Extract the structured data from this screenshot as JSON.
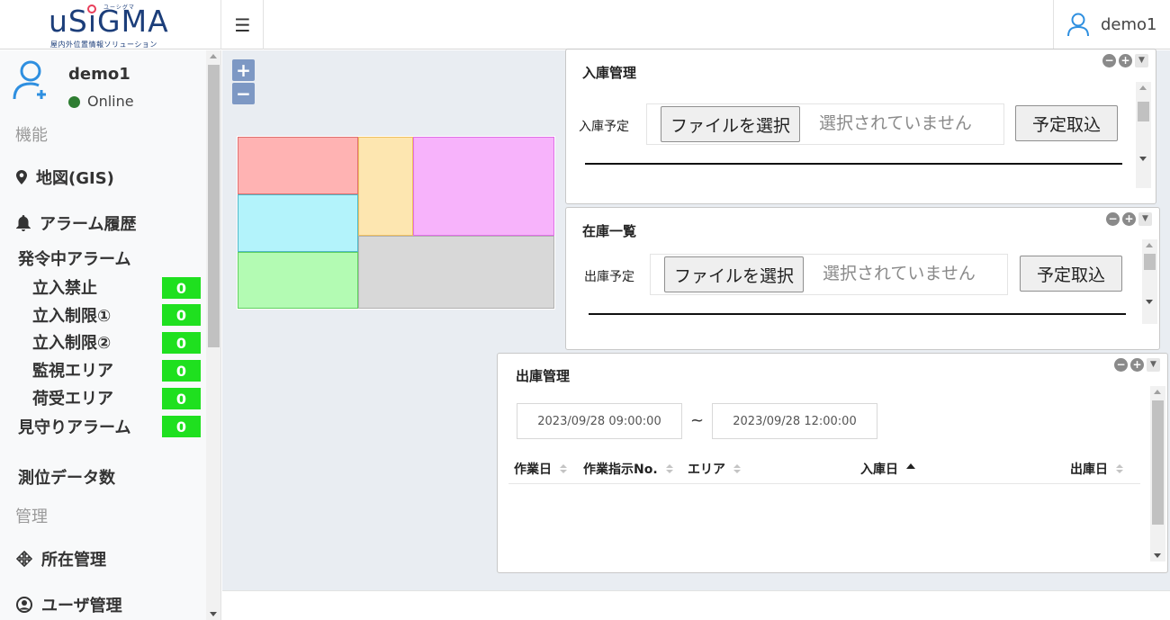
{
  "header": {
    "logo_text": "uSiGMA",
    "logo_ruby": "ユーシグマ",
    "logo_subtitle": "屋内外位置情報ソリューション",
    "menu_icon": "hamburger-icon",
    "user_name": "demo1"
  },
  "sidebar": {
    "profile_name": "demo1",
    "status": "Online",
    "status_color": "#2e7d32",
    "section_function": "機能",
    "nav_map": "地図(GIS)",
    "nav_alarm_history": "アラーム履歴",
    "active_alarms_label": "発令中アラーム",
    "alarms": [
      {
        "label": "立入禁止",
        "count": "0"
      },
      {
        "label": "立入制限①",
        "count": "0"
      },
      {
        "label": "立入制限②",
        "count": "0"
      },
      {
        "label": "監視エリア",
        "count": "0"
      },
      {
        "label": "荷受エリア",
        "count": "0"
      }
    ],
    "watch_alarm": {
      "label": "見守りアラーム",
      "count": "0"
    },
    "positioning_label": "測位データ数",
    "section_admin": "管理",
    "nav_location": "所在管理",
    "nav_users": "ユーザ管理",
    "badge_color": "#1fe01f"
  },
  "map": {
    "zoom_in": "+",
    "zoom_out": "−",
    "zone_colors": [
      "#ffb3b3",
      "#fde6b0",
      "#f7b3fb",
      "#b3f3fb",
      "#d8d8d8",
      "#b3fbb3"
    ]
  },
  "inbound_panel": {
    "title": "入庫管理",
    "row_label": "入庫予定",
    "file_button": "ファイルを選択",
    "file_status": "選択されていません",
    "import_button": "予定取込"
  },
  "stock_panel": {
    "title": "在庫一覧",
    "row_label": "出庫予定",
    "file_button": "ファイルを選択",
    "file_status": "選択されていません",
    "import_button": "予定取込"
  },
  "outbound_panel": {
    "title": "出庫管理",
    "date_from": "2023/09/28 09:00:00",
    "date_sep": "~",
    "date_to": "2023/09/28 12:00:00",
    "columns": [
      "作業日",
      "作業指示No.",
      "エリア",
      "入庫日",
      "出庫日"
    ]
  }
}
